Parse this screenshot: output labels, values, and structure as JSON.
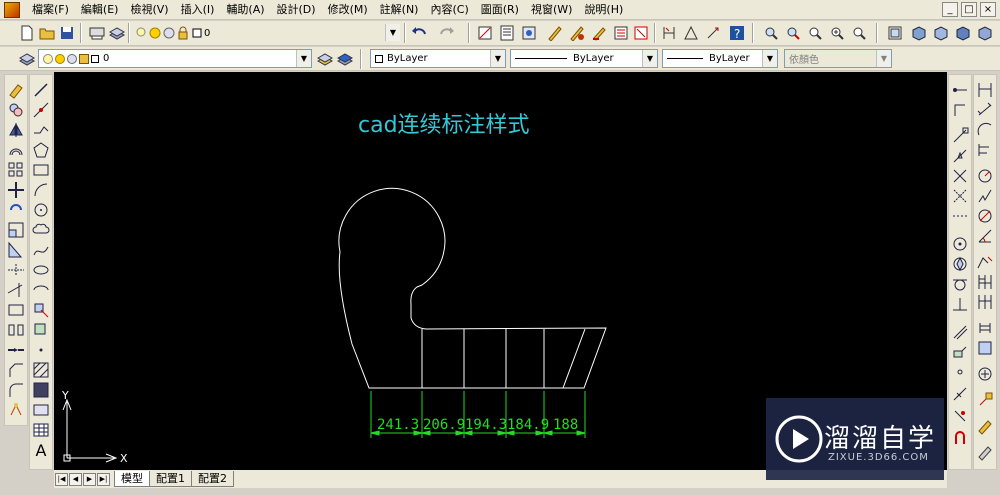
{
  "menubar": {
    "items": [
      "檔案(F)",
      "編輯(E)",
      "檢視(V)",
      "插入(I)",
      "輔助(A)",
      "設計(D)",
      "修改(M)",
      "註解(N)",
      "內容(C)",
      "圖面(R)",
      "視窗(W)",
      "說明(H)"
    ]
  },
  "window_controls": [
    "_",
    "□",
    "×"
  ],
  "layer_toolbar": {
    "layer_value_top": "0",
    "layer_value": "0"
  },
  "properties_toolbar": {
    "color": "ByLayer",
    "linetype": "ByLayer",
    "lineweight": "ByLayer",
    "plotstyle": "依顏色"
  },
  "drawing": {
    "title": "cad连续标注样式",
    "title_color": "#33c8d8",
    "dimension_color": "#22dd22",
    "dimensions": [
      "241.3",
      "206.9",
      "194.3",
      "184.9",
      "188"
    ],
    "ucs_x": "X",
    "ucs_y": "Y"
  },
  "tabs": {
    "items": [
      "模型",
      "配置1",
      "配置2"
    ],
    "active": "模型"
  },
  "watermark": {
    "brand": "溜溜自学",
    "url": "ZIXUE.3D66.COM"
  }
}
